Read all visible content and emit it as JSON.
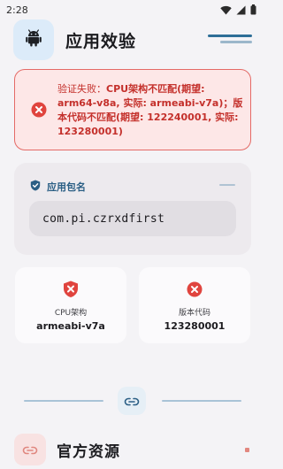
{
  "status_bar": {
    "time": "2:28",
    "icons": [
      "wifi-icon",
      "signal-icon",
      "battery-icon"
    ]
  },
  "header": {
    "title": "应用效验",
    "icon": "android-icon",
    "menu_icon": "menu-icon"
  },
  "error": {
    "icon": "error-circle-icon",
    "prefix": "验证失败：",
    "message": "CPU架构不匹配(期望: arm64-v8a, 实际: armeabi-v7a)；版本代码不匹配(期望: 122240001, 实际: 123280001)"
  },
  "package": {
    "label": "应用包名",
    "icon": "shield-check-icon",
    "value": "com.pi.czrxdfirst"
  },
  "cpu": {
    "label": "CPU架构",
    "value": "armeabi-v7a",
    "icon": "shield-error-icon"
  },
  "version": {
    "label": "版本代码",
    "value": "123280001",
    "icon": "error-circle-icon"
  },
  "divider": {
    "icon": "link-icon"
  },
  "resources": {
    "title": "官方资源",
    "icon": "link-icon"
  },
  "colors": {
    "error": "#e0443e",
    "accent": "#2e6e97",
    "background": "#f4f3f6"
  }
}
